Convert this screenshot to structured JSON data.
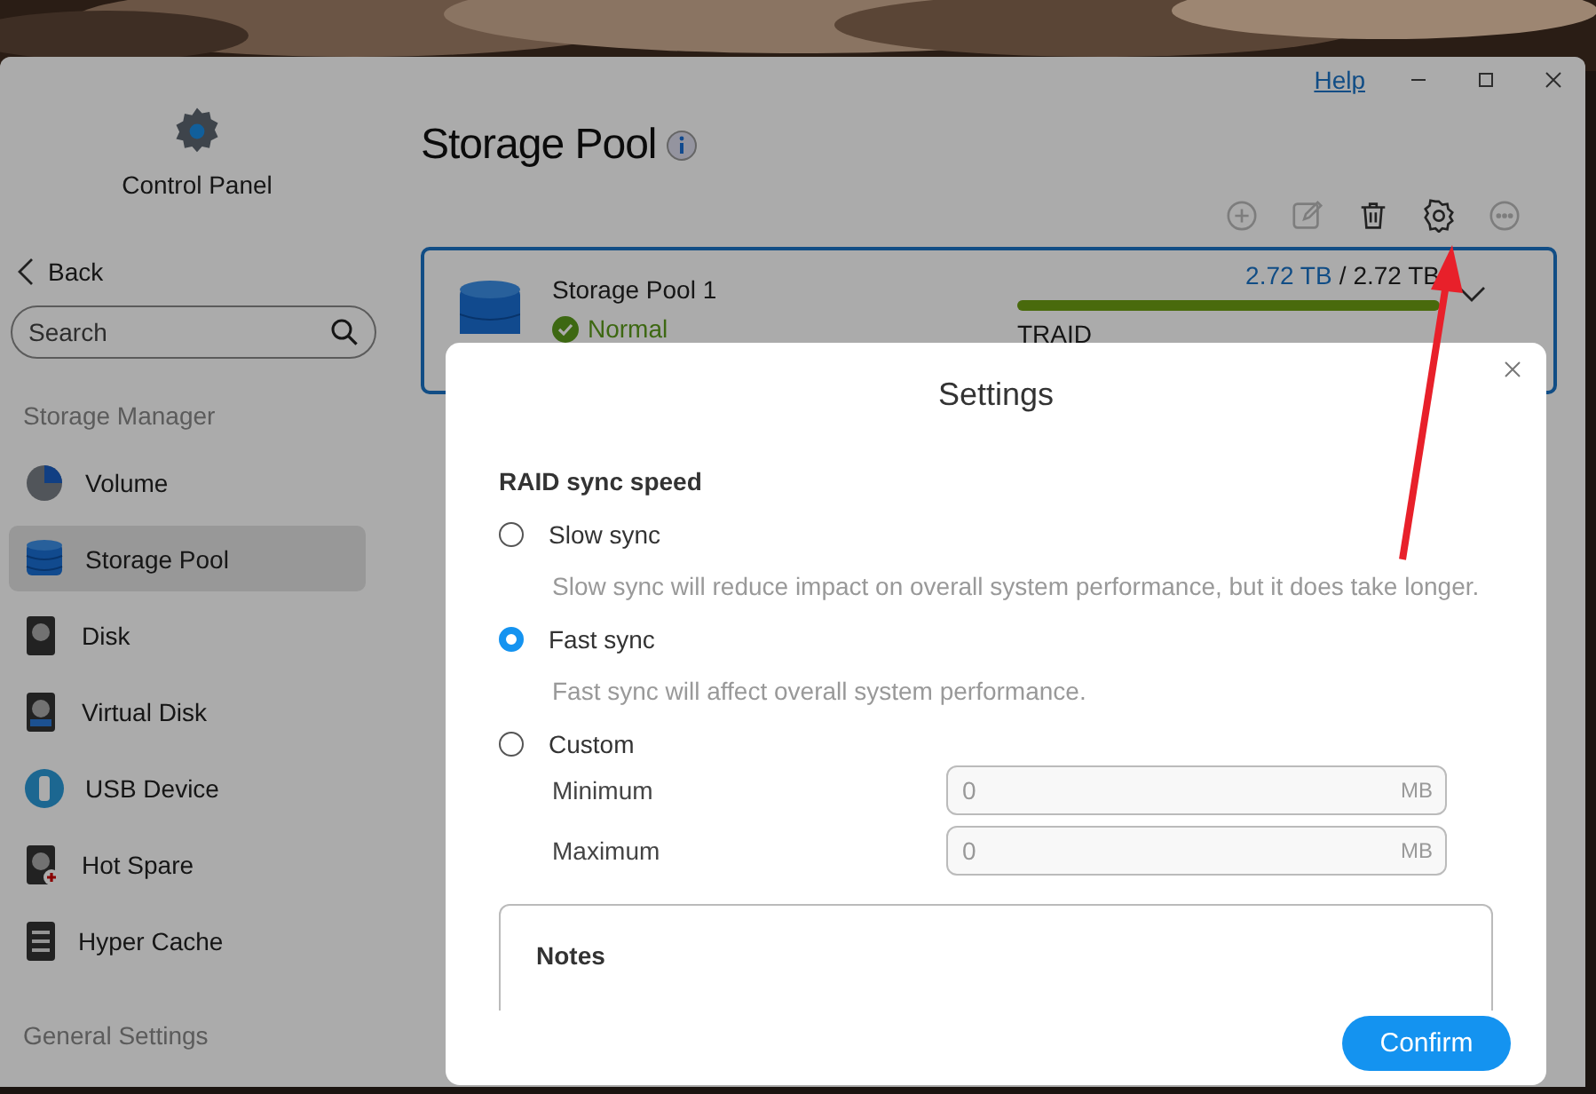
{
  "window": {
    "help_link": "Help"
  },
  "sidebar": {
    "app_title": "Control Panel",
    "back": "Back",
    "search": {
      "placeholder": "Search"
    },
    "sections": [
      {
        "title": "Storage Manager",
        "items": [
          {
            "kind": "volume",
            "label": "Volume",
            "selected": false
          },
          {
            "kind": "pool",
            "label": "Storage Pool",
            "selected": true
          },
          {
            "kind": "disk",
            "label": "Disk",
            "selected": false
          },
          {
            "kind": "vdisk",
            "label": "Virtual Disk",
            "selected": false
          },
          {
            "kind": "usb",
            "label": "USB Device",
            "selected": false
          },
          {
            "kind": "spare",
            "label": "Hot Spare",
            "selected": false
          },
          {
            "kind": "cache",
            "label": "Hyper Cache",
            "selected": false
          }
        ]
      },
      {
        "title": "General Settings"
      }
    ]
  },
  "main": {
    "title": "Storage Pool",
    "toolbar": [
      {
        "kind": "add",
        "disabled": true
      },
      {
        "kind": "edit",
        "disabled": true
      },
      {
        "kind": "delete",
        "disabled": false
      },
      {
        "kind": "settings",
        "disabled": false
      },
      {
        "kind": "more",
        "disabled": true
      }
    ],
    "pools": [
      {
        "name": "Storage Pool 1",
        "status": "Normal",
        "used": "2.72 TB",
        "separator": "/",
        "total": "2.72 TB",
        "level": 1,
        "raid": "TRAID",
        "expanded": false
      }
    ]
  },
  "dialog": {
    "title": "Settings",
    "section": "RAID sync speed",
    "options": [
      {
        "label": "Slow sync",
        "description": "Slow sync will reduce impact on overall system performance, but it does take longer.",
        "selected": false
      },
      {
        "label": "Fast sync",
        "description": "Fast sync will affect overall system performance.",
        "selected": true
      },
      {
        "label": "Custom",
        "selected": false,
        "fields": [
          {
            "label": "Minimum",
            "placeholder": "0",
            "unit": "MB"
          },
          {
            "label": "Maximum",
            "placeholder": "0",
            "unit": "MB"
          }
        ]
      }
    ],
    "notes_title": "Notes",
    "confirm": "Confirm"
  }
}
